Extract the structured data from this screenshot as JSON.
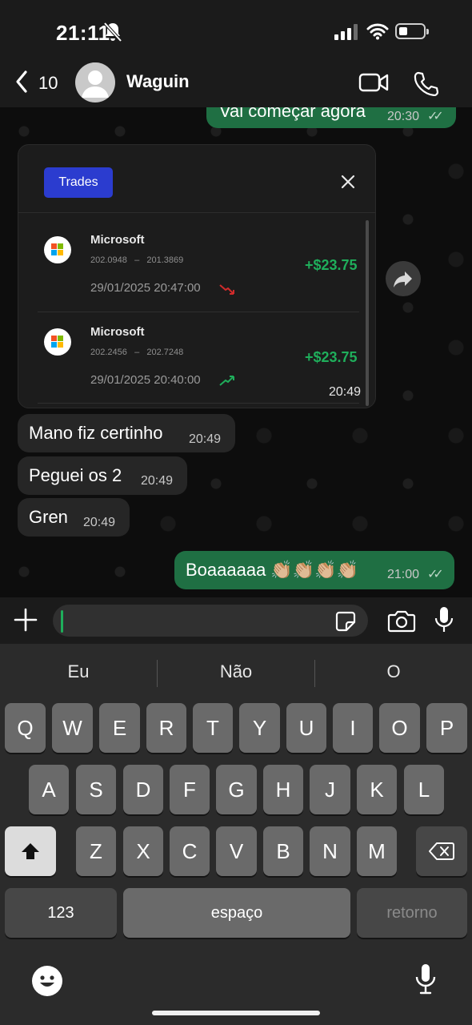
{
  "status_bar": {
    "time": "21:11"
  },
  "header": {
    "back_count": "10",
    "contact_name": "Waguin"
  },
  "messages": {
    "top_out": {
      "text": "Vai começar agora",
      "time": "20:30"
    },
    "card_time": "20:49",
    "in": [
      {
        "text": "Mano fiz certinho",
        "time": "20:49"
      },
      {
        "text": "Peguei os 2",
        "time": "20:49"
      },
      {
        "text": "Gren",
        "time": "20:49"
      }
    ],
    "bottom_out": {
      "text": "Boaaaaaa 👏🏼👏🏼👏🏼👏🏼",
      "time": "21:00"
    }
  },
  "trades_card": {
    "title": "Trades",
    "trades": [
      {
        "company": "Microsoft",
        "open_price": "202.0948",
        "close_price": "201.3869",
        "profit": "+$23.75",
        "datetime": "29/01/2025 20:47:00",
        "trend": "down"
      },
      {
        "company": "Microsoft",
        "open_price": "202.2456",
        "close_price": "202.7248",
        "profit": "+$23.75",
        "datetime": "29/01/2025 20:40:00",
        "trend": "up"
      }
    ],
    "price_sep": "–"
  },
  "keyboard": {
    "suggestions": [
      "Eu",
      "Não",
      "O"
    ],
    "row1": [
      "Q",
      "W",
      "E",
      "R",
      "T",
      "Y",
      "U",
      "I",
      "O",
      "P"
    ],
    "row2": [
      "A",
      "S",
      "D",
      "F",
      "G",
      "H",
      "J",
      "K",
      "L"
    ],
    "row3": [
      "Z",
      "X",
      "C",
      "V",
      "B",
      "N",
      "M"
    ],
    "numbers_label": "123",
    "space_label": "espaço",
    "return_label": "retorno"
  },
  "colors": {
    "outgoing_bubble": "#1f6f43",
    "incoming_bubble": "#262626",
    "accent_green": "#1fae5b",
    "trades_button": "#2b3ccf"
  },
  "icons": [
    "bell-slash-icon",
    "cellular-signal-icon",
    "wifi-icon",
    "battery-icon",
    "back-chevron-icon",
    "avatar-icon",
    "video-call-icon",
    "phone-icon",
    "close-icon",
    "microsoft-logo-icon",
    "trend-down-icon",
    "trend-up-icon",
    "forward-icon",
    "plus-icon",
    "sticker-icon",
    "camera-icon",
    "microphone-icon",
    "shift-icon",
    "backspace-icon",
    "emoji-icon"
  ]
}
